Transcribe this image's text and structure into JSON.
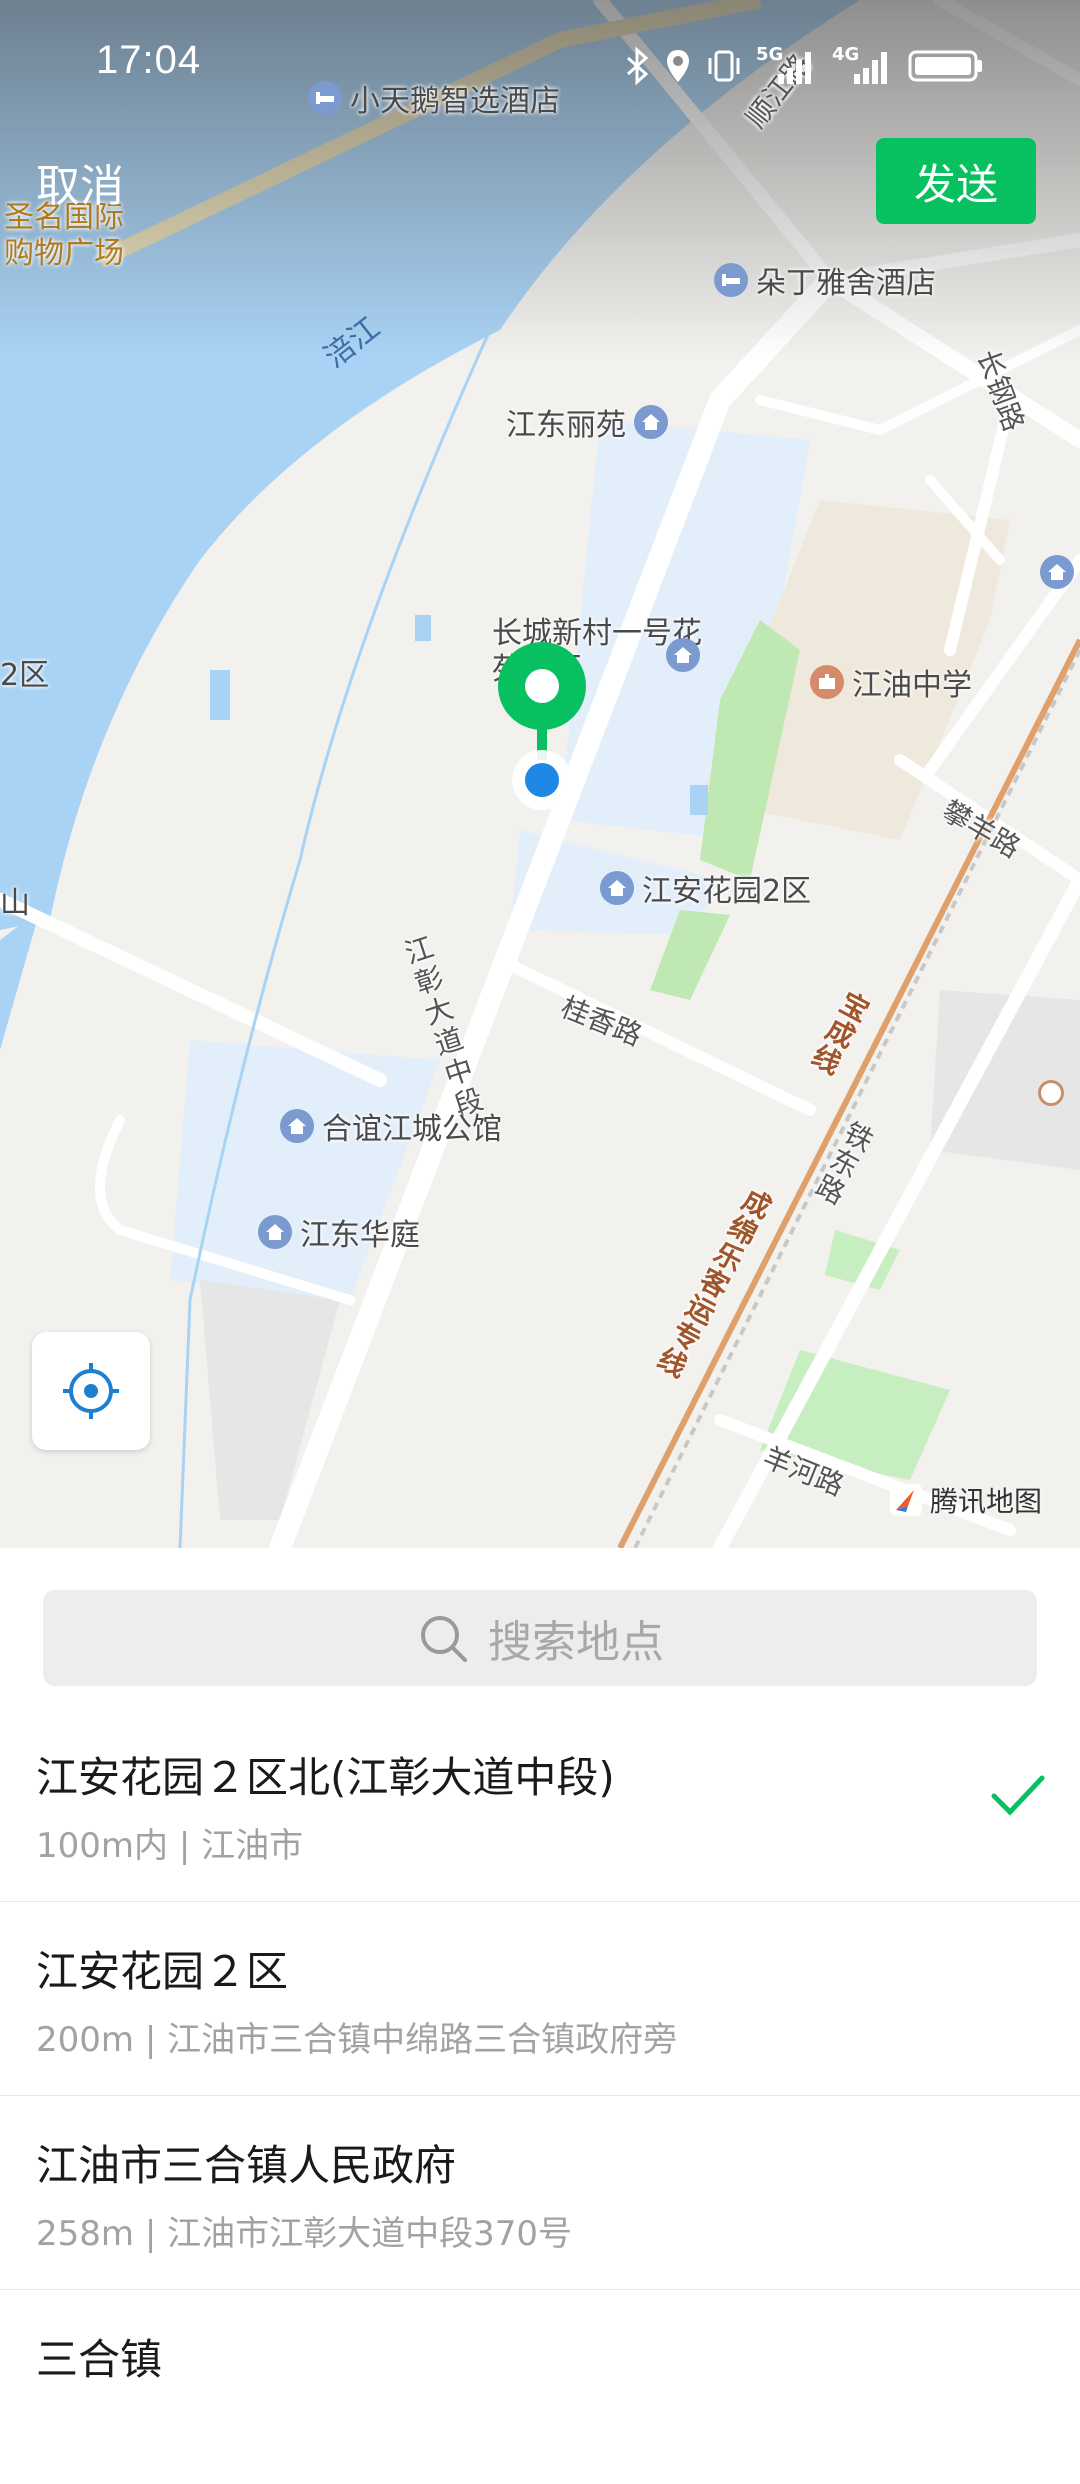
{
  "status": {
    "time": "17:04",
    "icons": [
      "bluetooth-icon",
      "location-icon",
      "vibrate-icon",
      "signal-5g-icon",
      "signal-4g-icon",
      "battery-icon"
    ],
    "net1": "5G",
    "net2": "4G"
  },
  "header": {
    "cancel_label": "取消",
    "send_label": "发送"
  },
  "map": {
    "labels": {
      "hotel1": "小天鹅智选酒店",
      "hotel2": "朵丁雅舍酒店",
      "mall": "圣名国际购物广场",
      "shunjiang": "顺江路",
      "river": "涪江",
      "jiangdong_liyuan": "江东丽苑",
      "changgang": "长钢路",
      "changcheng": "长城新村一号花苑小区",
      "school": "江油中学",
      "panyang": "攀羊路",
      "jiangan2": "江安花园2区",
      "jiangzhang": "江彰大道中段",
      "guixiang": "桂香路",
      "baocheng": "宝成线",
      "tiedong": "铁东路",
      "heyi": "合谊江城公馆",
      "jiangdong_huating": "江东华庭",
      "chengmian": "成绵乐客运专线",
      "yanghe": "羊河路",
      "edge_left1": "2区",
      "edge_left2": "山"
    },
    "logo": "腾讯地图"
  },
  "search": {
    "placeholder": "搜索地点"
  },
  "results": [
    {
      "title": "江安花园２区北(江彰大道中段)",
      "sub": "100m内 | 江油市",
      "selected": true
    },
    {
      "title": "江安花园２区",
      "sub": "200m | 江油市三合镇中绵路三合镇政府旁",
      "selected": false
    },
    {
      "title": "江油市三合镇人民政府",
      "sub": "258m | 江油市江彰大道中段370号",
      "selected": false
    },
    {
      "title": "三合镇",
      "sub": "",
      "selected": false
    }
  ],
  "colors": {
    "accent": "#07c160",
    "river": "#a9d3f5",
    "pin": "#07c160",
    "dot": "#1e88e5"
  }
}
